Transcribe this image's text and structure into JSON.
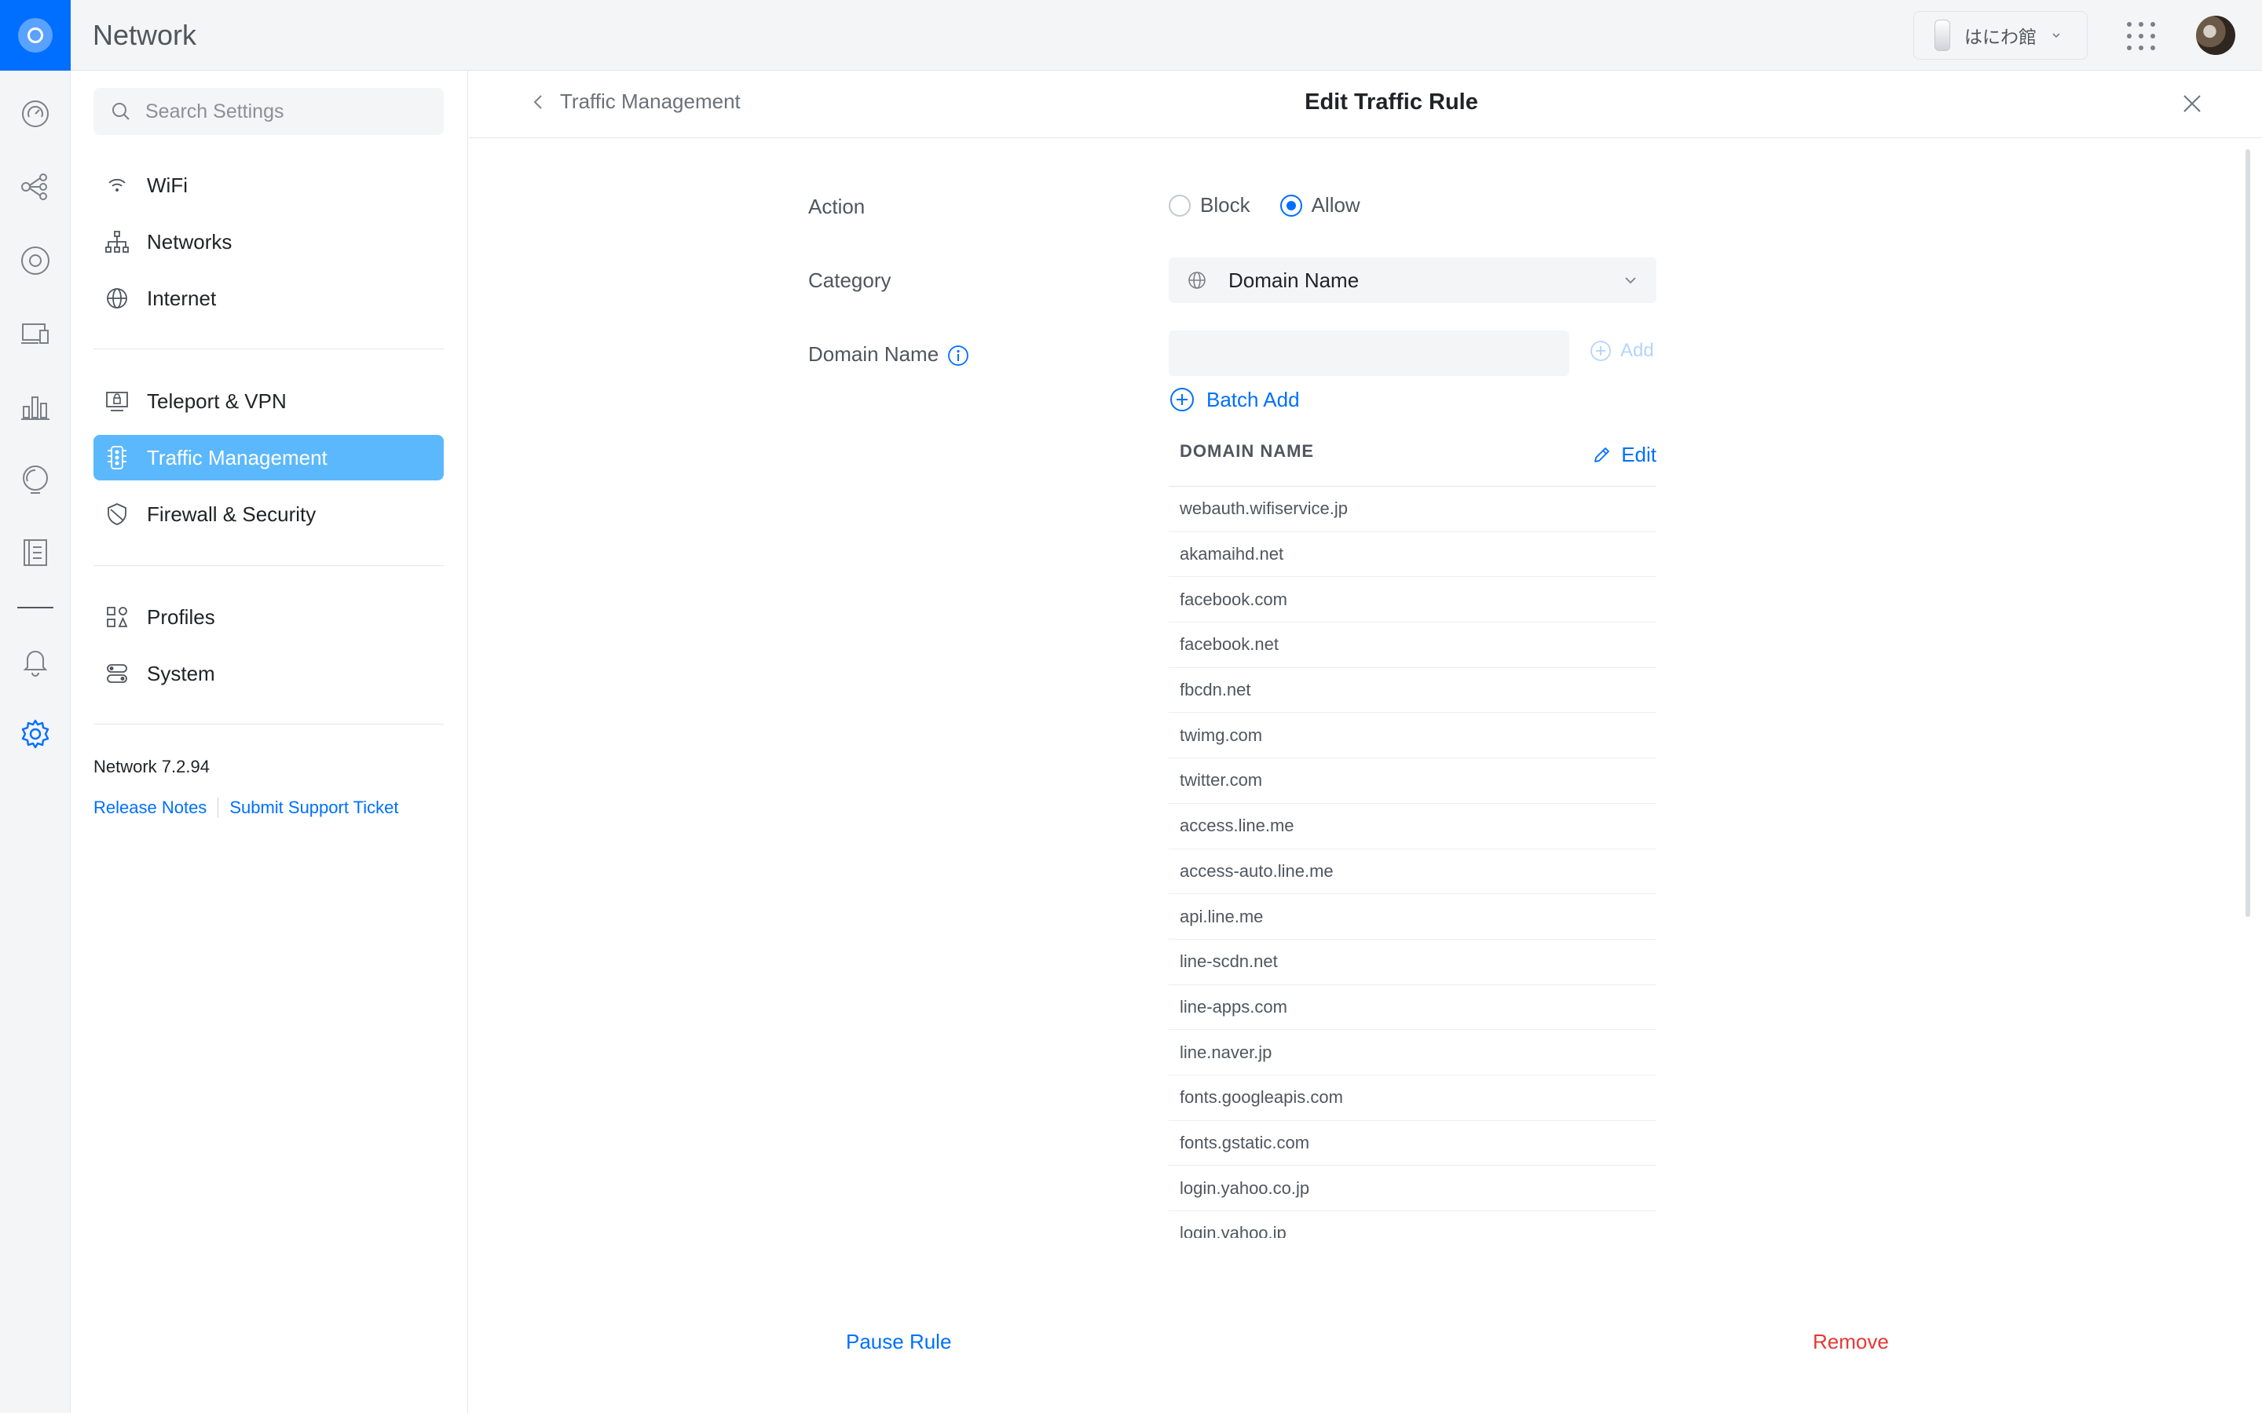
{
  "app": {
    "title": "Network",
    "site_name": "はにわ館"
  },
  "settings_nav": {
    "search_placeholder": "Search Settings",
    "items": [
      {
        "label": "WiFi"
      },
      {
        "label": "Networks"
      },
      {
        "label": "Internet"
      },
      {
        "label": "Teleport & VPN"
      },
      {
        "label": "Traffic Management",
        "active": true
      },
      {
        "label": "Firewall & Security"
      },
      {
        "label": "Profiles"
      },
      {
        "label": "System"
      }
    ],
    "version": "Network 7.2.94",
    "release_notes": "Release Notes",
    "support_ticket": "Submit Support Ticket"
  },
  "panel": {
    "back_label": "Traffic Management",
    "title": "Edit Traffic Rule",
    "action": {
      "label": "Action",
      "options": [
        "Block",
        "Allow"
      ],
      "selected": "Allow"
    },
    "category": {
      "label": "Category",
      "value": "Domain Name"
    },
    "domain_field": {
      "label": "Domain Name",
      "value": "",
      "add_label": "Add"
    },
    "batch_add_label": "Batch Add",
    "table": {
      "column": "DOMAIN NAME",
      "edit_label": "Edit",
      "rows": [
        "webauth.wifiservice.jp",
        "akamaihd.net",
        "facebook.com",
        "facebook.net",
        "fbcdn.net",
        "twimg.com",
        "twitter.com",
        "access.line.me",
        "access-auto.line.me",
        "api.line.me",
        "line-scdn.net",
        "line-apps.com",
        "line.naver.jp",
        "fonts.googleapis.com",
        "fonts.gstatic.com",
        "login.yahoo.co.jp",
        "login.yahoo.jp"
      ]
    },
    "pause_label": "Pause Rule",
    "remove_label": "Remove"
  },
  "colors": {
    "accent": "#006fff",
    "active_nav": "#5cb8fc",
    "danger": "#e53935"
  }
}
